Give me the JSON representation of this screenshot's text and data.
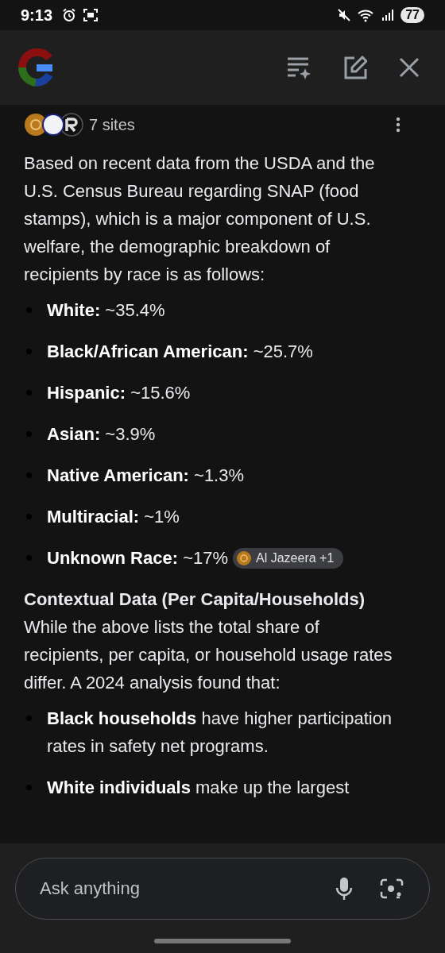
{
  "status_bar": {
    "time": "9:13",
    "battery": "77"
  },
  "sources": {
    "label": "7 sites"
  },
  "intro": "Based on recent data from the USDA and the U.S. Census Bureau regarding SNAP (food stamps), which is a major component of U.S. welfare, the demographic breakdown of recipients by race is as follows:",
  "race_list": [
    {
      "text": "**White:** ~35.4%"
    },
    {
      "text": "**Black/African American:** ~25.7%"
    },
    {
      "text": "**Hispanic:** ~15.6%"
    },
    {
      "text": "**Asian:** ~3.9%"
    },
    {
      "text": "**Native American:** ~1.3%"
    },
    {
      "text": "**Multiracial:** ~1%"
    },
    {
      "text": "**Unknown Race:** ~17%",
      "citation": "Al Jazeera +1"
    }
  ],
  "section": {
    "heading": "Contextual Data (Per Capita/Households)",
    "text": "While the above lists the total share of recipients, per capita, or household usage rates differ. A 2024 analysis found that:"
  },
  "findings": [
    {
      "text": "**Black households** have higher participation rates in safety net programs."
    },
    {
      "text": "**White individuals** make up the largest"
    }
  ],
  "input": {
    "placeholder": "Ask anything"
  }
}
